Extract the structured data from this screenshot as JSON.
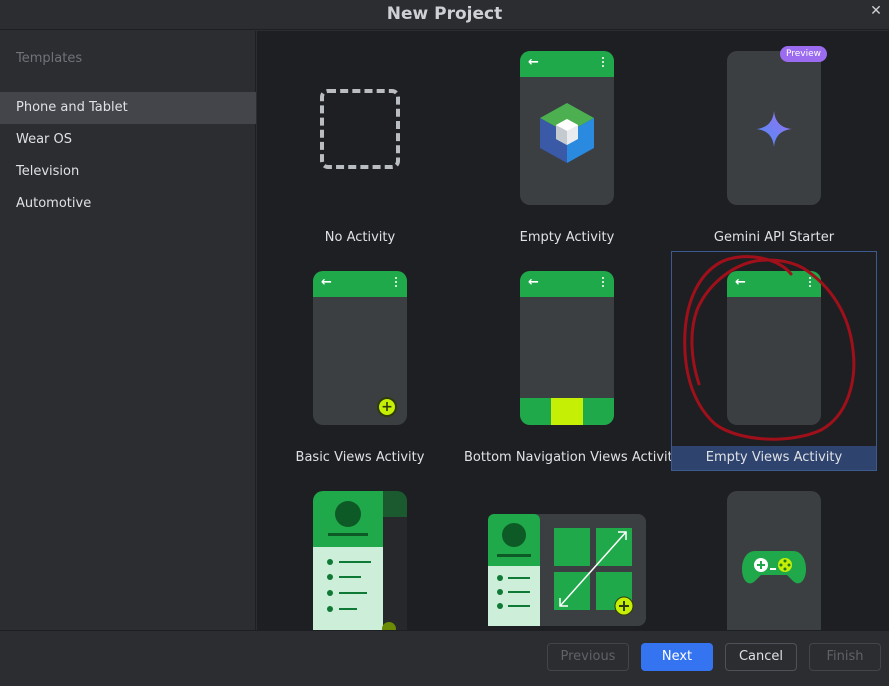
{
  "window": {
    "title": "New Project",
    "close_icon": "✕"
  },
  "sidebar": {
    "header": "Templates",
    "items": [
      {
        "label": "Phone and Tablet",
        "selected": true
      },
      {
        "label": "Wear OS"
      },
      {
        "label": "Television"
      },
      {
        "label": "Automotive"
      }
    ]
  },
  "templates": [
    {
      "label": "No Activity",
      "icon": "dashed-box-icon"
    },
    {
      "label": "Empty Activity",
      "icon": "compose-cube-icon"
    },
    {
      "label": "Gemini API Starter",
      "badge": "Preview",
      "icon": "gemini-sparkle-icon"
    },
    {
      "label": "Basic Views Activity",
      "icon": "fab-plus-icon"
    },
    {
      "label": "Bottom Navigation Views Activity",
      "icon": "bottom-nav-icon"
    },
    {
      "label": "Empty Views Activity",
      "selected": true
    },
    {
      "label": "",
      "icon": "list-detail-icon"
    },
    {
      "label": "",
      "icon": "responsive-grid-icon"
    },
    {
      "label": "",
      "icon": "game-controller-icon"
    }
  ],
  "footer": {
    "previous": "Previous",
    "next": "Next",
    "cancel": "Cancel",
    "finish": "Finish"
  },
  "colors": {
    "accent": "#3574f0",
    "android_green": "#1fa94a",
    "lime": "#c6ef06",
    "annotation_red": "#a0101a"
  }
}
